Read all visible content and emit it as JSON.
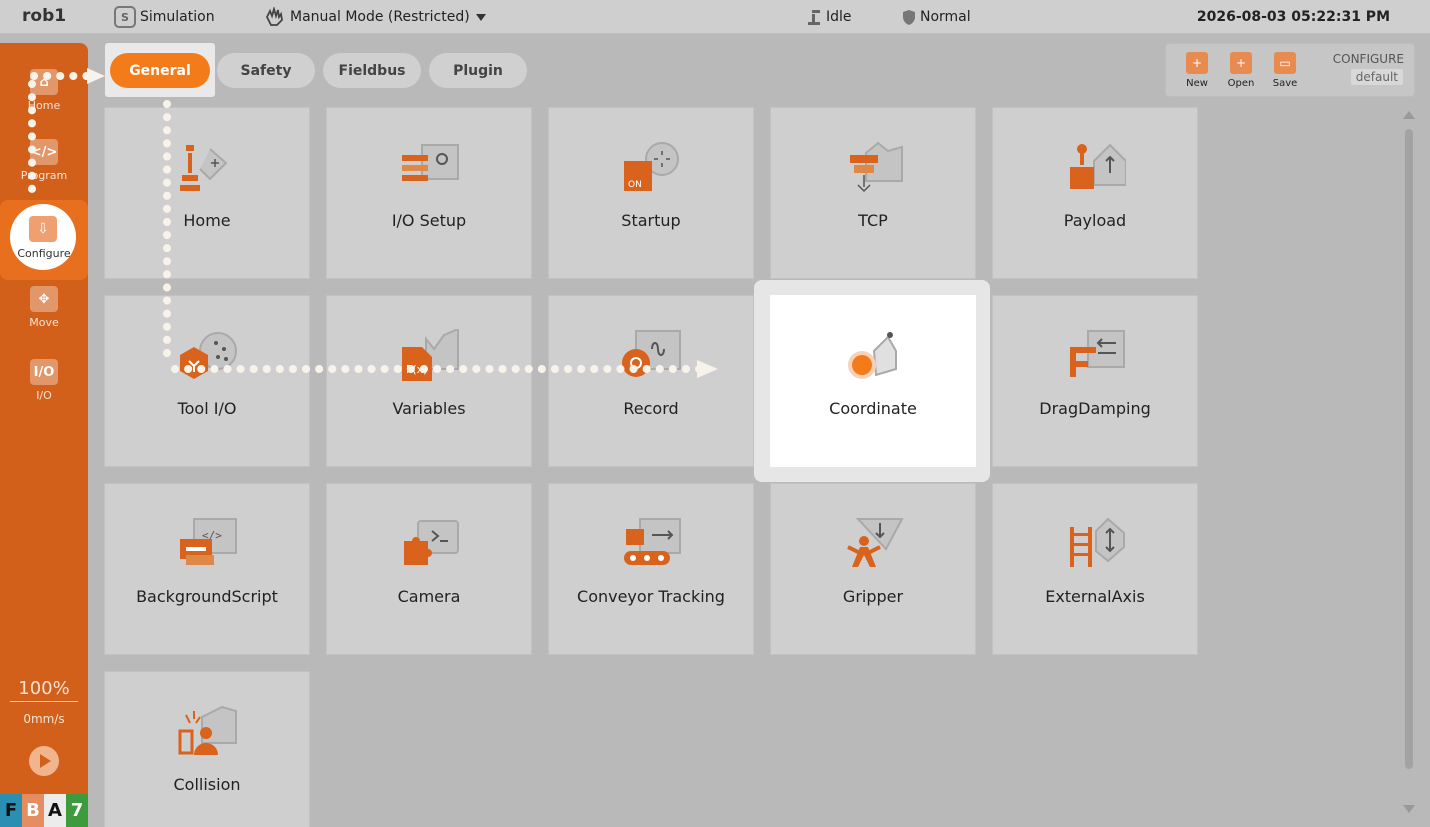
{
  "topbar": {
    "robot_name": "rob1",
    "sim_badge": "S",
    "simulation": "Simulation",
    "mode": "Manual Mode (Restricted)",
    "status": "Idle",
    "safety": "Normal",
    "datetime": "2026-08-03 05:22:31 PM"
  },
  "sidebar": {
    "items": [
      {
        "label": "Home",
        "icon": "home-icon"
      },
      {
        "label": "Program",
        "icon": "code-icon"
      },
      {
        "label": "Configure",
        "icon": "configure-icon"
      },
      {
        "label": "Move",
        "icon": "move-icon"
      },
      {
        "label": "I/O",
        "icon": "io-icon"
      }
    ],
    "speed_percent": "100%",
    "speed_mms": "0mm/s",
    "status_letters": [
      "F",
      "B",
      "A",
      "7"
    ]
  },
  "tabs": [
    {
      "label": "General",
      "active": true
    },
    {
      "label": "Safety",
      "active": false
    },
    {
      "label": "Fieldbus",
      "active": false
    },
    {
      "label": "Plugin",
      "active": false
    }
  ],
  "config_bar": {
    "new_label": "New",
    "open_label": "Open",
    "save_label": "Save",
    "title": "CONFIGURE",
    "name": "default"
  },
  "tiles": [
    {
      "label": "Home"
    },
    {
      "label": "I/O Setup"
    },
    {
      "label": "Startup"
    },
    {
      "label": "TCP"
    },
    {
      "label": "Payload"
    },
    {
      "label": "Tool I/O"
    },
    {
      "label": "Variables"
    },
    {
      "label": "Record"
    },
    {
      "label": "Coordinate",
      "highlighted": true
    },
    {
      "label": "DragDamping"
    },
    {
      "label": "BackgroundScript"
    },
    {
      "label": "Camera"
    },
    {
      "label": "Conveyor Tracking"
    },
    {
      "label": "Gripper"
    },
    {
      "label": "ExternalAxis"
    },
    {
      "label": "Collision"
    }
  ],
  "colors": {
    "accent": "#f47b1a",
    "sidebar": "#d2601a",
    "icon_orange": "#d9621c",
    "icon_gray": "#a9a9a9"
  }
}
